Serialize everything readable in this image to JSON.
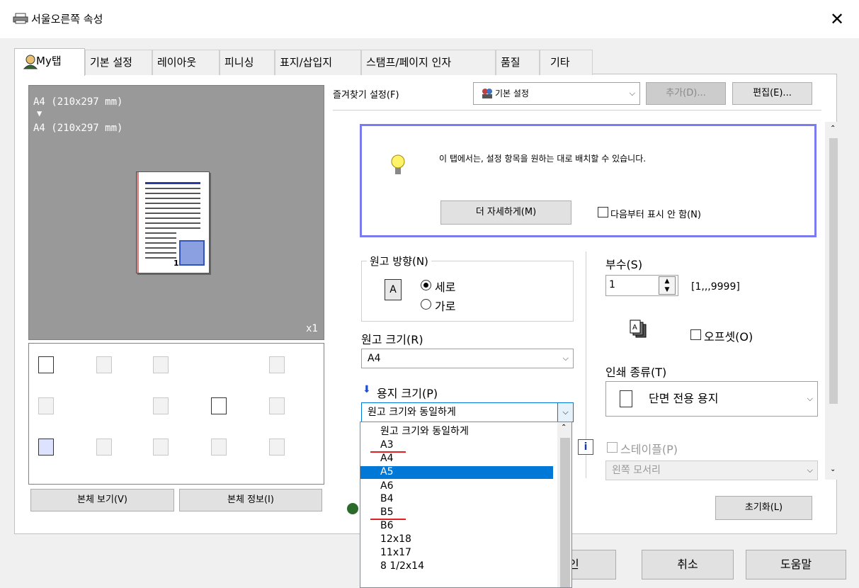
{
  "window": {
    "title": "서울오른쪽 속성",
    "close": "✕"
  },
  "tabs": [
    "My탭",
    "기본 설정",
    "레이아웃",
    "피니싱",
    "표지/삽입지",
    "스탬프/페이지 인자",
    "품질",
    "기타"
  ],
  "preview": {
    "original_size": "A4 (210x297 mm)",
    "arrow": "▼",
    "output_size": "A4 (210x297 mm)",
    "copies_badge": "x1",
    "page_number": "1"
  },
  "left_buttons": {
    "view": "본체 보기(V)",
    "info": "본체 정보(I)"
  },
  "favorites": {
    "label": "즐겨찾기 설정(F)",
    "selected": "기본 설정",
    "add": "추가(D)...",
    "edit": "편집(E)..."
  },
  "info": {
    "text": "이 탭에서는, 설정 항목을 원하는 대로 배치할 수 있습니다.",
    "more_button": "더 자세하게(M)",
    "dont_show": "다음부터 표시 안 함(N)"
  },
  "orientation": {
    "label": "원고 방향(N)",
    "portrait": "세로",
    "landscape": "가로",
    "selected": "portrait"
  },
  "original_size": {
    "label": "원고 크기(R)",
    "value": "A4"
  },
  "paper_size": {
    "label": "용지 크기(P)",
    "value": "원고 크기와 동일하게",
    "options": [
      "원고 크기와 동일하게",
      "A3",
      "A4",
      "A5",
      "A6",
      "B4",
      "B5",
      "B6",
      "12x18",
      "11x17",
      "8 1/2x14"
    ],
    "highlighted": "A5",
    "underlined": [
      "A3",
      "B5"
    ]
  },
  "copies": {
    "label": "부수(S)",
    "value": "1",
    "range": "[1,,,9999]"
  },
  "offset": {
    "label": "오프셋(O)",
    "checked": false
  },
  "print_type": {
    "label": "인쇄 종류(T)",
    "value": "단면 전용 용지"
  },
  "staple": {
    "label": "스테이플(P)",
    "value": "왼쪽 모서리"
  },
  "reset_button": "초기화(L)",
  "footer_buttons": {
    "ok_partial": "인",
    "cancel": "취소",
    "help": "도움말"
  }
}
